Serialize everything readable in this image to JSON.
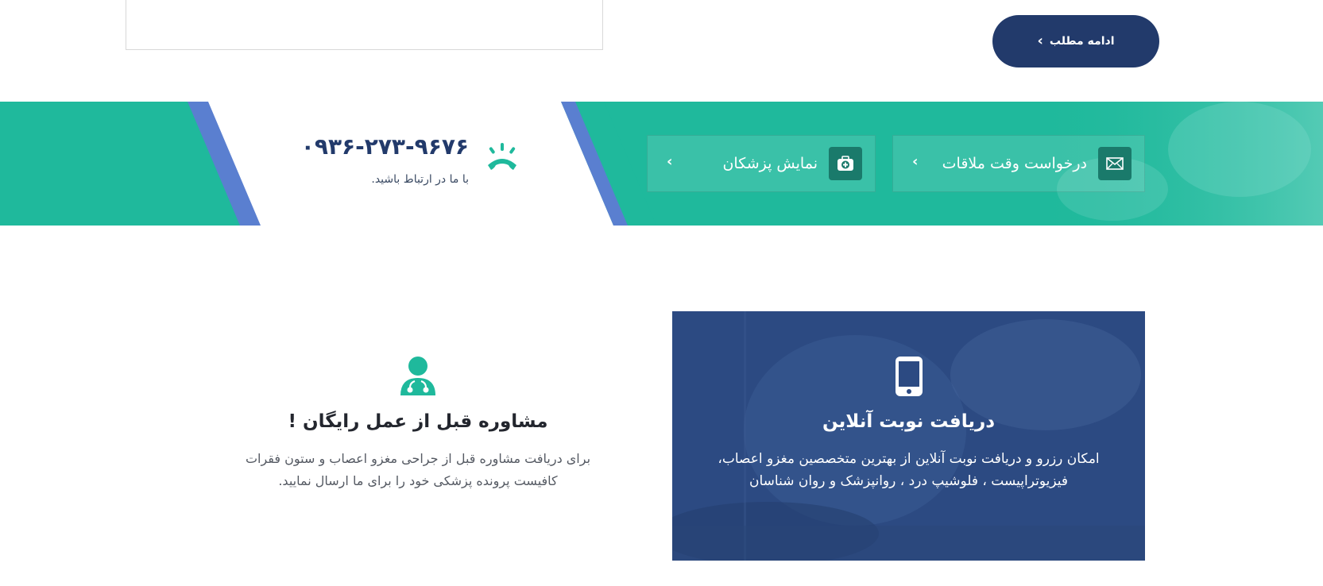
{
  "top": {
    "read_more_label": "ادامه مطلب"
  },
  "contact": {
    "phone": "۰۹۳۶-۲۷۳-۹۶۷۶",
    "subtitle": "با ما در ارتباط باشید."
  },
  "band_buttons": {
    "appointment_label": "درخواست وقت ملاقات",
    "doctors_label": "نمایش پزشکان"
  },
  "features": {
    "online": {
      "title": "دریافت نوبت آنلاین",
      "body": "امکان رزرو و دریافت نوبت آنلاین از بهترین متخصصین مغزو اعصاب، فیزیوتراپیست ، فلوشیپ درد ، روانپزشک و روان شناسان",
      "icon": "mobile-phone-icon"
    },
    "consult": {
      "title": "مشاوره قبل از عمل رایگان !",
      "body": "برای دریافت مشاوره قبل از جراحی مغزو اعصاب و ستون فقرات کافیست پرونده پزشکی خود را برای ما ارسال نمایید.",
      "icon": "doctor-icon"
    }
  },
  "colors": {
    "teal": "#1fb99c",
    "navy": "#223a6b",
    "card_blue": "#2c4a82",
    "blue_stripe": "#5a7fd0"
  }
}
